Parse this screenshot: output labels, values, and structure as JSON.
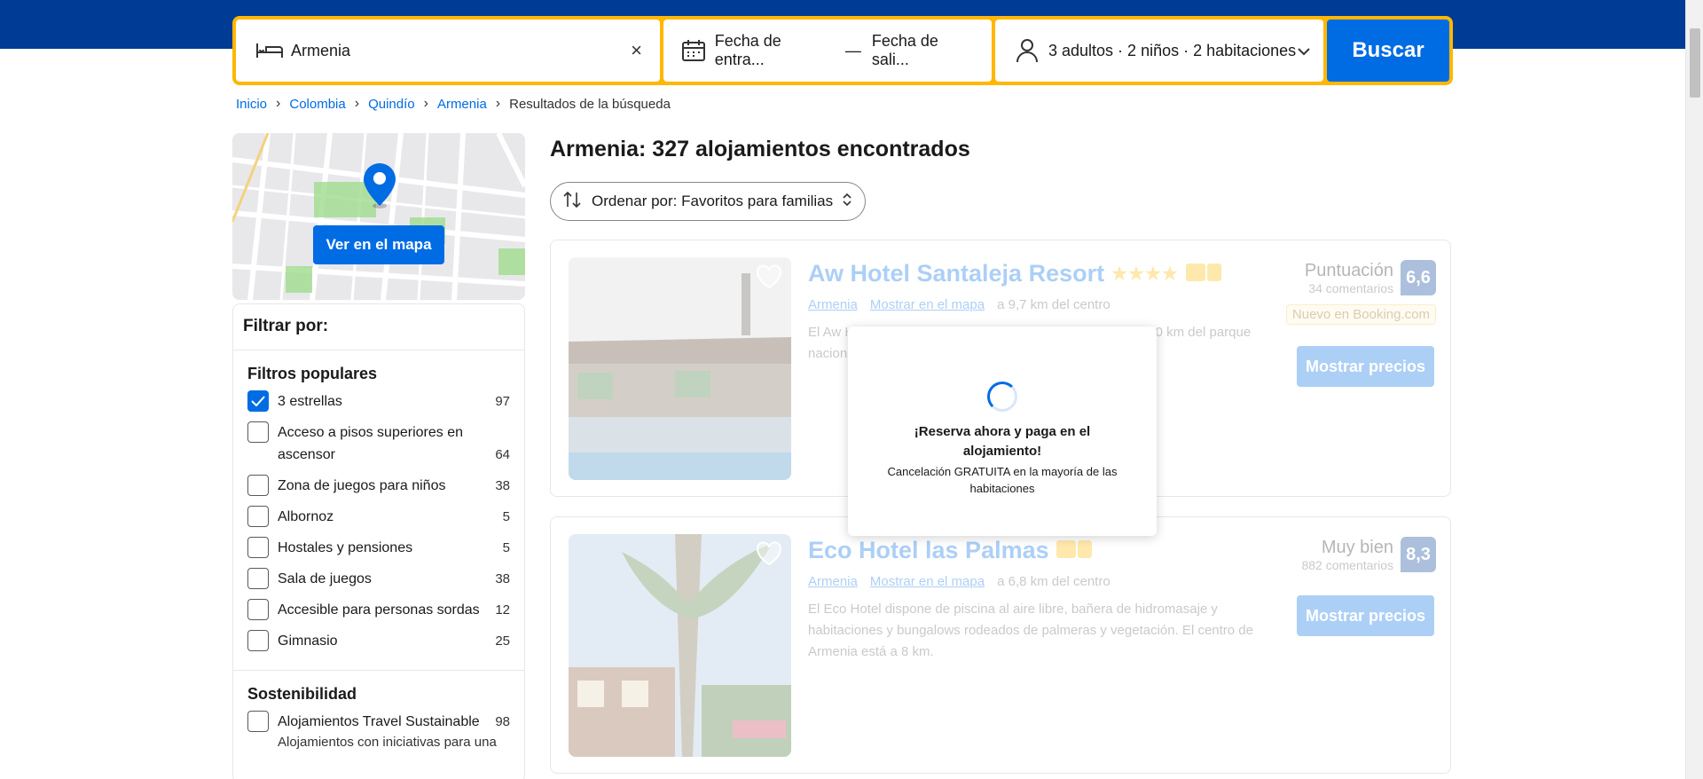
{
  "search": {
    "destination": "Armenia",
    "checkin": "Fecha de entra...",
    "dash": "—",
    "checkout": "Fecha de sali...",
    "guests": "3 adultos · 2 niños · 2 habitaciones",
    "button": "Buscar",
    "clear_icon": "×"
  },
  "breadcrumb": {
    "items": [
      "Inicio",
      "Colombia",
      "Quindío",
      "Armenia"
    ],
    "current": "Resultados de la búsqueda"
  },
  "map": {
    "button": "Ver en el mapa"
  },
  "filters": {
    "title": "Filtrar por:",
    "popular": {
      "title": "Filtros populares",
      "items": [
        {
          "label": "3 estrellas",
          "count": "97",
          "checked": true
        },
        {
          "label": "Acceso a pisos superiores en ascensor",
          "count": "64",
          "checked": false
        },
        {
          "label": "Zona de juegos para niños",
          "count": "38",
          "checked": false
        },
        {
          "label": "Albornoz",
          "count": "5",
          "checked": false
        },
        {
          "label": "Hostales y pensiones",
          "count": "5",
          "checked": false
        },
        {
          "label": "Sala de juegos",
          "count": "38",
          "checked": false
        },
        {
          "label": "Accesible para personas sordas",
          "count": "12",
          "checked": false
        },
        {
          "label": "Gimnasio",
          "count": "25",
          "checked": false
        }
      ]
    },
    "sustainability": {
      "title": "Sostenibilidad",
      "item": {
        "label": "Alojamientos Travel Sustainable",
        "count": "98",
        "sub": "Alojamientos con iniciativas para una"
      }
    }
  },
  "results": {
    "title": "Armenia: 327 alojamientos encontrados",
    "sort": "Ordenar por: Favoritos para familias"
  },
  "hotels": [
    {
      "name": "Aw Hotel Santaleja Resort",
      "stars": "★★★★",
      "city": "Armenia",
      "map_link": "Mostrar en el mapa",
      "distance": "a 9,7 km del centro",
      "description": "El Aw Hotel Santaleja Resort se encuentra en Armenia, a 20 km del parque nacional... aparcamiento privado gratuito...",
      "score_word": "Puntuación",
      "reviews": "34 comentarios",
      "score": "6,6",
      "badge": "Nuevo en Booking.com",
      "button": "Mostrar precios"
    },
    {
      "name": "Eco Hotel las Palmas",
      "city": "Armenia",
      "map_link": "Mostrar en el mapa",
      "distance": "a 6,8 km del centro",
      "description": "El Eco Hotel dispone de piscina al aire libre, bañera de hidromasaje y habitaciones y bungalows rodeados de palmeras y vegetación. El centro de Armenia está a 8 km.",
      "score_word": "Muy bien",
      "reviews": "882 comentarios",
      "score": "8,3",
      "button": "Mostrar precios"
    }
  ],
  "overlay": {
    "title": "¡Reserva ahora y paga en el alojamiento!",
    "subtitle": "Cancelación GRATUITA en la mayoría de las habitaciones"
  },
  "colors": {
    "brand": "#003b95",
    "accent": "#006ce4",
    "search_border": "#ffb700"
  }
}
